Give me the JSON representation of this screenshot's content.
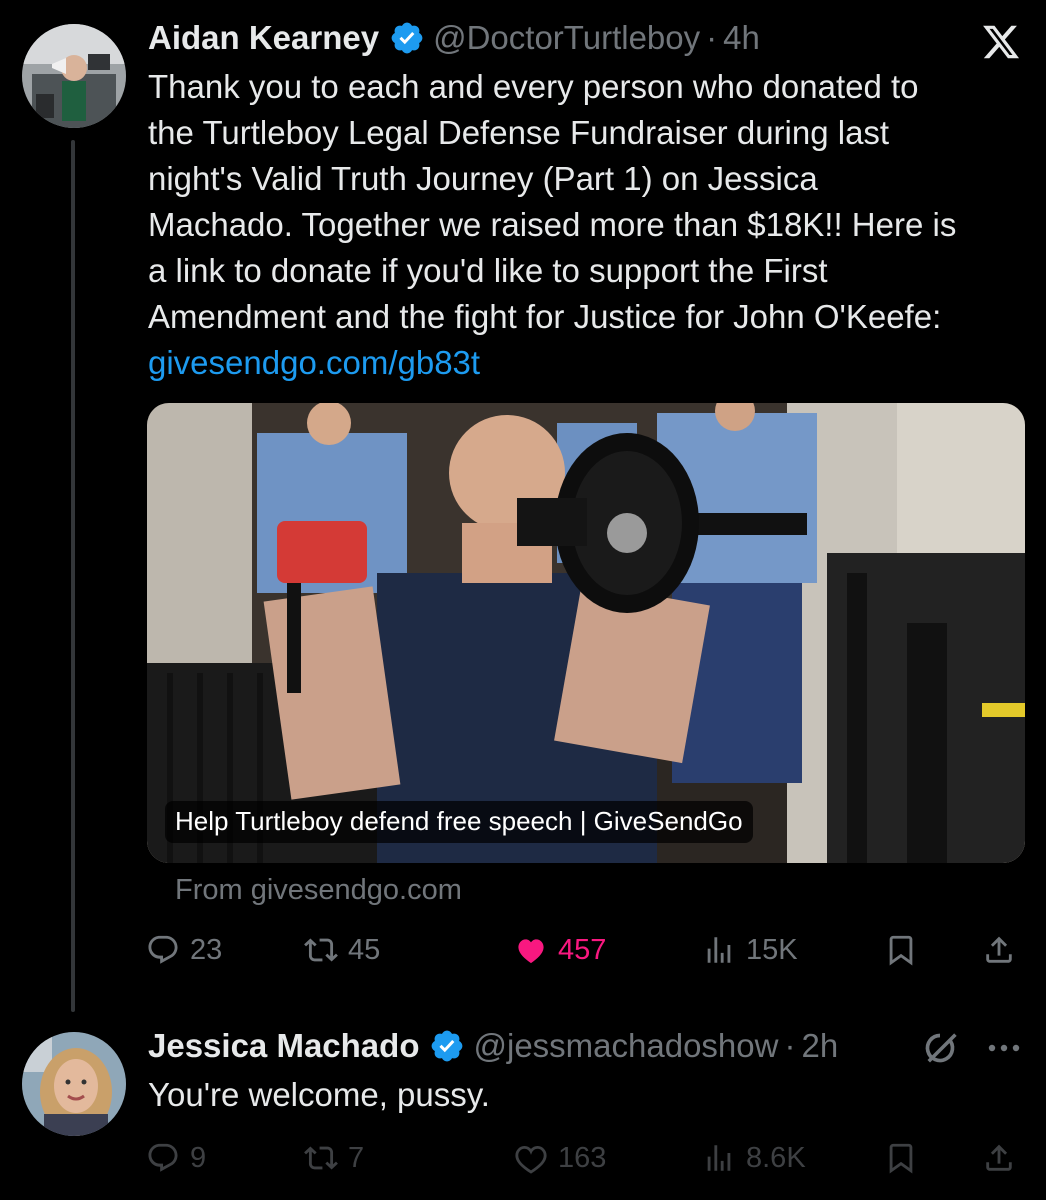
{
  "tweet": {
    "author_name": "Aidan Kearney",
    "author_handle": "@DoctorTurtleboy",
    "separator": "·",
    "time": "4h",
    "body": "Thank you to each and every person who donated to\nthe Turtleboy Legal Defense Fundraiser during last\nnight's Valid Truth Journey (Part 1) on Jessica\nMachado. Together we raised more than $18K!! Here is\na link to donate if you'd like to support the First\nAmendment and the fight for Justice for John O'Keefe:",
    "link": "givesendgo.com/gb83t",
    "card": {
      "caption": "Help Turtleboy defend free speech | GiveSendGo",
      "source": "From givesendgo.com"
    },
    "stats": {
      "replies": "23",
      "reposts": "45",
      "likes": "457",
      "views": "15K"
    },
    "liked": true,
    "like_color": "#f91880",
    "icons": {
      "brand": "x-logo-icon",
      "verified": "verified-badge-icon"
    }
  },
  "reply": {
    "author_name": "Jessica Machado",
    "author_handle": "@jessmachadoshow",
    "separator": "·",
    "time": "2h",
    "body": "You're welcome, pussy.",
    "stats": {
      "replies": "9",
      "reposts": "7",
      "likes": "163",
      "views": "8.6K"
    },
    "icons": {
      "grok": "grok-icon",
      "more": "more-icon"
    }
  },
  "colors": {
    "background": "#000000",
    "text": "#e7e9ea",
    "muted": "#71767b",
    "link": "#1d9bf0",
    "verified": "#1d9bf0"
  }
}
